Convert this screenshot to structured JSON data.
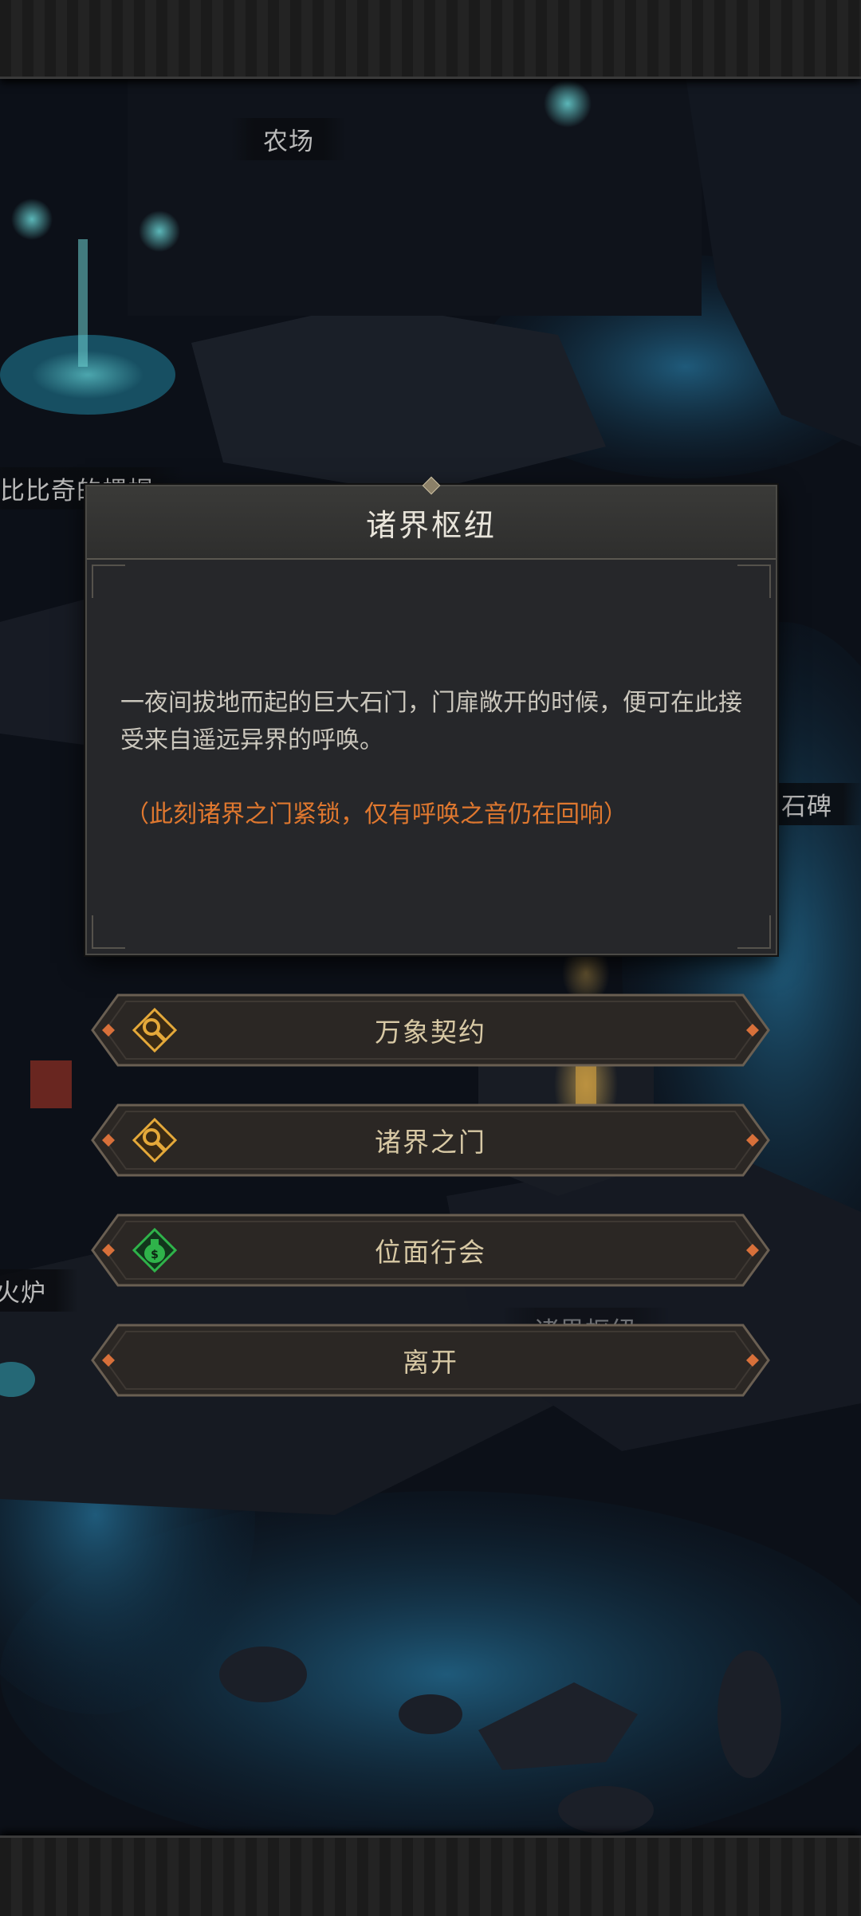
{
  "map_labels": {
    "farm": "农场",
    "bibiqi": "比比奇的螺帽",
    "stele": "石碑",
    "furnace": "火炉",
    "hub_bg": "诸界枢纽"
  },
  "dialog": {
    "title": "诸界枢纽",
    "description": "一夜间拔地而起的巨大石门，门扉敞开的时候，便可在此接受来自遥远异界的呼唤。",
    "note": "（此刻诸界之门紧锁，仅有呼唤之音仍在回响）"
  },
  "menu": [
    {
      "label": "万象契约",
      "icon": "key-search-icon"
    },
    {
      "label": "诸界之门",
      "icon": "key-search-icon"
    },
    {
      "label": "位面行会",
      "icon": "money-bag-icon"
    },
    {
      "label": "离开",
      "icon": ""
    }
  ],
  "colors": {
    "dialog_bg": "#26272a",
    "title_text": "#e8e4da",
    "note_text": "#e0782f",
    "button_text": "#d8c9a5",
    "icon_gold": "#e5a93a",
    "icon_green": "#2fb34a"
  }
}
